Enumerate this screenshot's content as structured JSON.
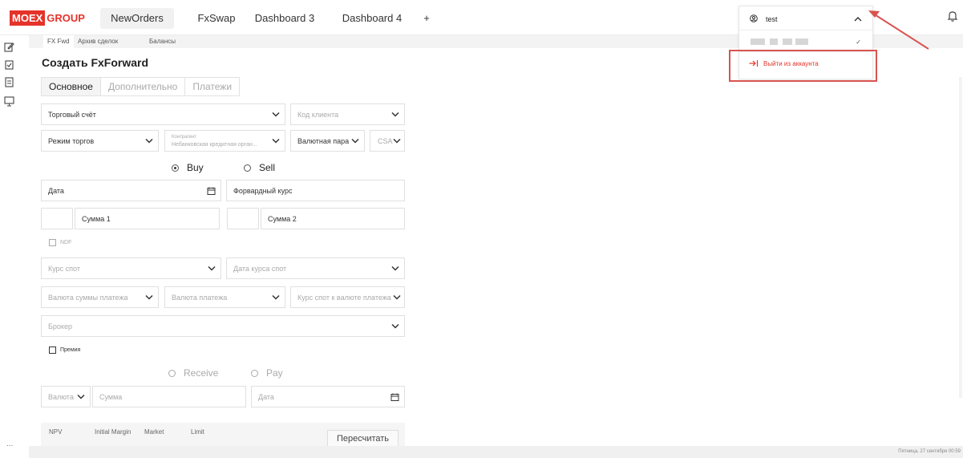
{
  "brand": {
    "logo_left": "MOEX",
    "logo_right": "GROUP"
  },
  "nav": {
    "tabs": [
      {
        "label": "NewOrders",
        "active": true
      },
      {
        "label": "FxSwap",
        "active": false
      },
      {
        "label": "Dashboard 3",
        "active": false
      },
      {
        "label": "Dashboard 4",
        "active": false
      }
    ],
    "add_label": "+"
  },
  "subtabs": [
    "FX Fwd",
    "Архив сделок",
    "Балансы"
  ],
  "page_title": "Создать FxForward",
  "segments": [
    "Основное",
    "Дополнительно",
    "Платежи"
  ],
  "form": {
    "trade_account": "Торговый счёт",
    "client_code": "Код клиента",
    "trade_mode": "Режим торгов",
    "counterparty_caption": "Контрагент",
    "counterparty_value": "Небанковская кредитная орган...",
    "currency_pair": "Валютная пара",
    "csa": "CSA",
    "buy": "Buy",
    "sell": "Sell",
    "date": "Дата",
    "forward_rate": "Форвардный курс",
    "amount1": "Сумма 1",
    "amount2": "Сумма 2",
    "ndf": "NDF",
    "spot_rate": "Курс спот",
    "spot_rate_date": "Дата курса спот",
    "payment_amount_currency": "Валюта суммы платежа",
    "payment_currency": "Валюта платежа",
    "spot_to_payment": "Курс спот к валюте платежа",
    "broker": "Брокер",
    "premium": "Премия",
    "receive": "Receive",
    "pay": "Pay",
    "currency": "Валюта",
    "amount": "Сумма",
    "date2": "Дата"
  },
  "summary": {
    "npv": "NPV",
    "initial_margin": "Initial Margin",
    "market": "Market",
    "limit": "Limit",
    "recalc": "Пересчитать"
  },
  "account_menu": {
    "username": "test",
    "logout": "Выйти из аккаунта"
  },
  "status": {
    "datetime": "Пятница, 27 сентября 00:59",
    "more": "..."
  },
  "colors": {
    "brand_red": "#e5332a",
    "highlight_border": "#d9534f"
  }
}
